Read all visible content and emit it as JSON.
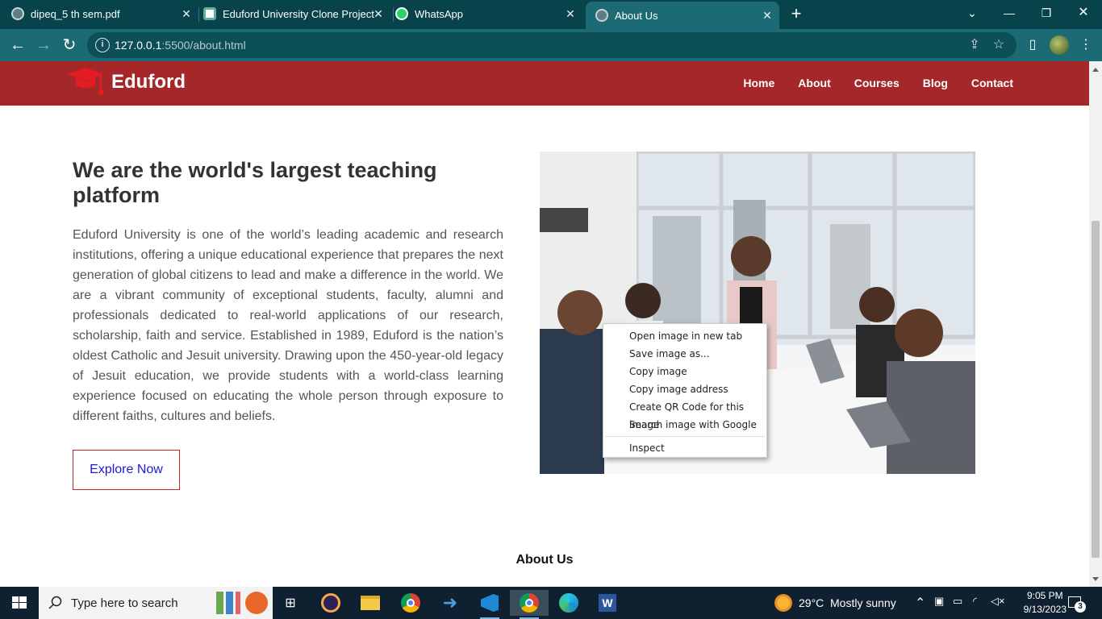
{
  "browser": {
    "tabs": [
      {
        "title": "dipeq_5 th sem.pdf",
        "icon": "globe-icon",
        "active": false
      },
      {
        "title": "Eduford University Clone Project",
        "icon": "chatgpt-icon",
        "active": false
      },
      {
        "title": "WhatsApp",
        "icon": "whatsapp-icon",
        "active": false
      },
      {
        "title": "About Us",
        "icon": "globe-icon",
        "active": true
      }
    ],
    "close_glyph": "✕",
    "new_tab_glyph": "+",
    "url_host": "127.0.0.1",
    "url_path": ":5500/about.html"
  },
  "site": {
    "brand": "Eduford",
    "nav": [
      "Home",
      "About",
      "Courses",
      "Blog",
      "Contact"
    ],
    "accent_color": "#a5272a"
  },
  "hero": {
    "title": "We are the world's largest teaching platform",
    "body": "Eduford University is one of the world’s leading academic and research institutions, offering a unique educational experience that prepares the next generation of global citizens to lead and make a difference in the world. We are a vibrant community of exceptional students, faculty, alumni and professionals dedicated to real-world applications of our research, scholarship, faith and service. Established in 1989, Eduford is the nation’s oldest Catholic and Jesuit university. Drawing upon the 450-year-old legacy of Jesuit education, we provide students with a world-class learning experience focused on educating the whole person through exposure to different faiths, cultures and beliefs.",
    "button": "Explore Now"
  },
  "section_title": "About Us",
  "context_menu": {
    "items": [
      "Open image in new tab",
      "Save image as...",
      "Copy image",
      "Copy image address",
      "Create QR Code for this image",
      "Search image with Google"
    ],
    "footer_item": "Inspect"
  },
  "taskbar": {
    "search_placeholder": "Type here to search",
    "weather_temp": "29°C",
    "weather_desc": "Mostly sunny",
    "time": "9:05 PM",
    "date": "9/13/2023",
    "notification_count": "3"
  }
}
